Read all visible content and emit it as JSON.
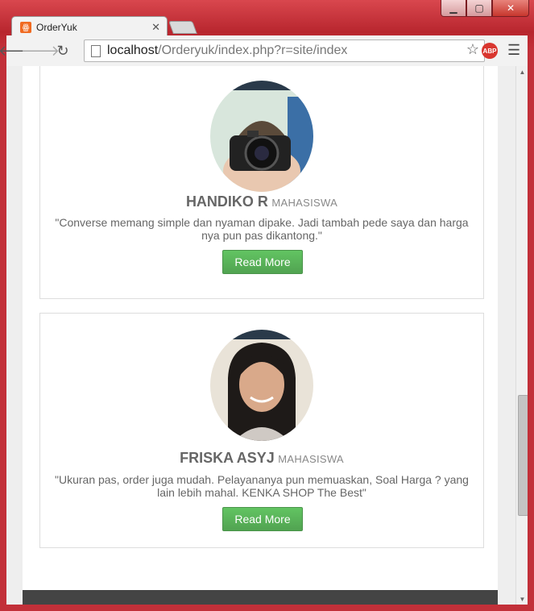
{
  "browser": {
    "tab_title": "OrderYuk",
    "tab_icon": "xampp-icon",
    "url_host": "localhost",
    "url_path": "/Orderyuk/index.php?r=site/index",
    "abp_label": "ABP"
  },
  "testimonials": [
    {
      "name": "HANDIKO R",
      "role": "MAHASISWA",
      "quote": "\"Converse memang simple dan nyaman dipake. Jadi tambah pede saya dan harga nya pun pas dikantong.\"",
      "button_label": "Read More"
    },
    {
      "name": "FRISKA ASYJ",
      "role": "MAHASISWA",
      "quote": "\"Ukuran pas, order juga mudah. Pelayananya pun memuaskan, Soal Harga ? yang lain lebih mahal. KENKA SHOP The Best\"",
      "button_label": "Read More"
    }
  ],
  "colors": {
    "button_green": "#5cb85c",
    "window_red": "#c9323a"
  }
}
